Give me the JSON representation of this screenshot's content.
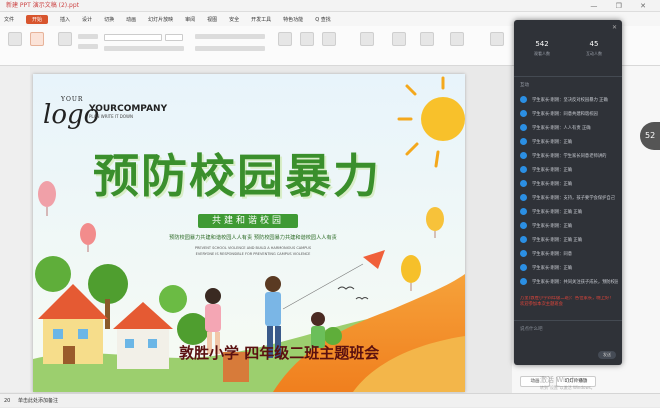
{
  "window": {
    "title": "新建 PPT 演示文稿 (2).ppt",
    "controls": "— ❐ ✕"
  },
  "menu": {
    "items": [
      "文件",
      "开始",
      "插入",
      "设计",
      "切换",
      "动画",
      "幻灯片放映",
      "审阅",
      "视图",
      "安全",
      "开发工具",
      "特色功能",
      "Q 查找"
    ]
  },
  "slide": {
    "logo_word": "logo",
    "logo_your": "YOUR",
    "company": "YOURCOMPANY",
    "company_tagline": "PLAN WRITE IT DOWN",
    "title": "预防校园暴力",
    "subtitle": "共建和谐校园",
    "banner_text": "预防校园暴力共建和谐校园人人有责 预防校园暴力共建和谐校园人人有责",
    "small_text_1": "PREVENT SCHOOL VIOLENCE AND BUILD A HARMONIOUS CAMPUS",
    "small_text_2": "EVERYONE IS RESPONSIBLE FOR PREVENTING CAMPUS VIOLENCE",
    "caption": "敦胜小学 四年级二班主题班会"
  },
  "panel": {
    "stats": [
      {
        "value": "542",
        "label": "观看人数"
      },
      {
        "value": "45",
        "label": "互动人数"
      }
    ],
    "section_title": "互动",
    "messages": [
      "学生家长·刚刚：坚决反对校园暴力 正确",
      "学生家长·刚刚：同意共建和谐校园",
      "学生家长·刚刚：人人有责 正确",
      "学生家长·刚刚：正确",
      "学生家长·刚刚：学生家长同意老师讲的",
      "学生家长·刚刚：正确",
      "学生家长·刚刚：正确",
      "学生家长·刚刚：支持，孩子要学会保护自己",
      "学生家长·刚刚：正确 正确",
      "学生家长·刚刚：正确",
      "学生家长·刚刚：正确 正确",
      "学生家长·刚刚：同意",
      "学生家长·刚刚：正确",
      "学生家长·刚刚：共同关注孩子成长，预防校园暴力，共建和谐校园"
    ],
    "highlight": "万里(敦胜小学四年级二班)：各位家长，晚上好！欢迎参加本次主题班会",
    "input_placeholder": "说点什么吧",
    "send_label": "发送"
  },
  "right_pane": {
    "buttons": [
      "动画",
      "幻灯片播放"
    ],
    "side_label": "52"
  },
  "status": {
    "page": "20",
    "text": "单击此处添加备注",
    "watermark_1": "激活 Windows",
    "watermark_2": "转到\"设置\"以激活 Windows。"
  },
  "colors": {
    "accent": "#d8552e",
    "title_green": "#3a8f2c",
    "panel_bg": "#2f3238",
    "avatar_blue": "#2b8fe3",
    "highlight_red": "#e2453b"
  }
}
